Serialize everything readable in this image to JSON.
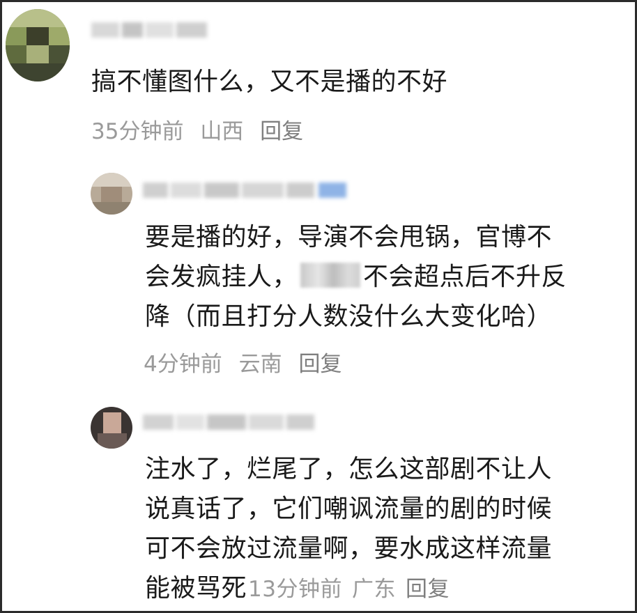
{
  "comments": [
    {
      "text": "搞不懂图什么，又不是播的不好",
      "time": "35分钟前",
      "location": "山西",
      "reply_label": "回复"
    },
    {
      "lines": [
        "要是播的好，导演不会甩锅，官博不",
        "不会超点后不升反",
        "降（而且打分人数没什么大变化哈）"
      ],
      "line2_prefix": "会发疯挂人，",
      "time": "4分钟前",
      "location": "云南",
      "reply_label": "回复"
    },
    {
      "lines": [
        "注水了，烂尾了，怎么这部剧不让人",
        "说真话了，它们嘲讽流量的剧的时候",
        "可不会放过流量啊，要水成这样流量",
        "能被骂死"
      ],
      "time": "13分钟前",
      "location": "广东",
      "reply_label": "回复"
    }
  ],
  "colors": {
    "text": "#1a1a1a",
    "meta": "#9a9a9a",
    "border": "#2b2b2b"
  }
}
